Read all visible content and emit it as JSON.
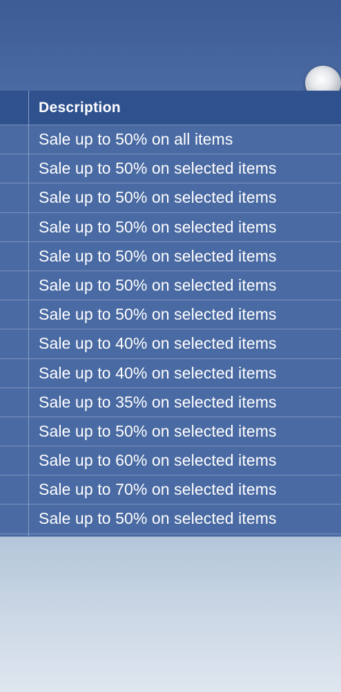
{
  "table": {
    "header": {
      "description_label": "Description"
    },
    "rows": [
      {
        "description": "Sale up to 50% on all items"
      },
      {
        "description": "Sale up to 50% on selected items"
      },
      {
        "description": "Sale up to 50% on selected items"
      },
      {
        "description": "Sale up to 50% on selected items"
      },
      {
        "description": "Sale up to 50% on selected items"
      },
      {
        "description": "Sale up to 50% on selected items"
      },
      {
        "description": "Sale up to 50% on selected items"
      },
      {
        "description": "Sale up to 40% on selected items"
      },
      {
        "description": "Sale up to 40% on selected items"
      },
      {
        "description": "Sale up to 35% on selected items"
      },
      {
        "description": "Sale up to 50% on selected items"
      },
      {
        "description": "Sale up to 60% on selected items"
      },
      {
        "description": "Sale up to 70% on selected items"
      },
      {
        "description": "Sale up to 50% on selected items"
      }
    ]
  },
  "decor": {
    "orb_icon": "sphere-orb-icon",
    "colors": {
      "header_bg": "#2f528f",
      "row_bg": "#4a6aa3",
      "text": "#ffffff"
    }
  }
}
